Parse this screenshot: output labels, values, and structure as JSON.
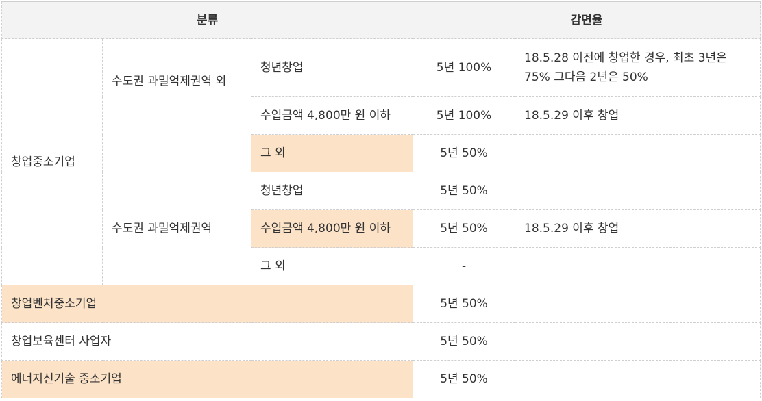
{
  "header": {
    "category": "분류",
    "rate": "감면율"
  },
  "rows": {
    "startup_sme": "창업중소기업",
    "outside_capital": "수도권 과밀억제권역 외",
    "inside_capital": "수도권 과밀억제권역",
    "r1": {
      "type": "청년창업",
      "rate": "5년 100%",
      "note": "18.5.28 이전에 창업한 경우, 최초 3년은 75% 그다음 2년은 50%"
    },
    "r2": {
      "type": "수입금액 4,800만 원 이하",
      "rate": "5년 100%",
      "note": "18.5.29 이후 창업"
    },
    "r3": {
      "type": "그 외",
      "rate": "5년 50%",
      "note": ""
    },
    "r4": {
      "type": "청년창업",
      "rate": "5년 50%",
      "note": ""
    },
    "r5": {
      "type": "수입금액 4,800만 원 이하",
      "rate": "5년 50%",
      "note": "18.5.29 이후 창업"
    },
    "r6": {
      "type": "그 외",
      "rate": "-",
      "note": ""
    },
    "r7": {
      "type": "창업벤처중소기업",
      "rate": "5년 50%",
      "note": ""
    },
    "r8": {
      "type": "창업보육센터 사업자",
      "rate": "5년 50%",
      "note": ""
    },
    "r9": {
      "type": "에너지신기술 중소기업",
      "rate": "5년 50%",
      "note": ""
    }
  },
  "colors": {
    "highlight": "#fce3c8",
    "header_bg": "#f3f3f3"
  }
}
